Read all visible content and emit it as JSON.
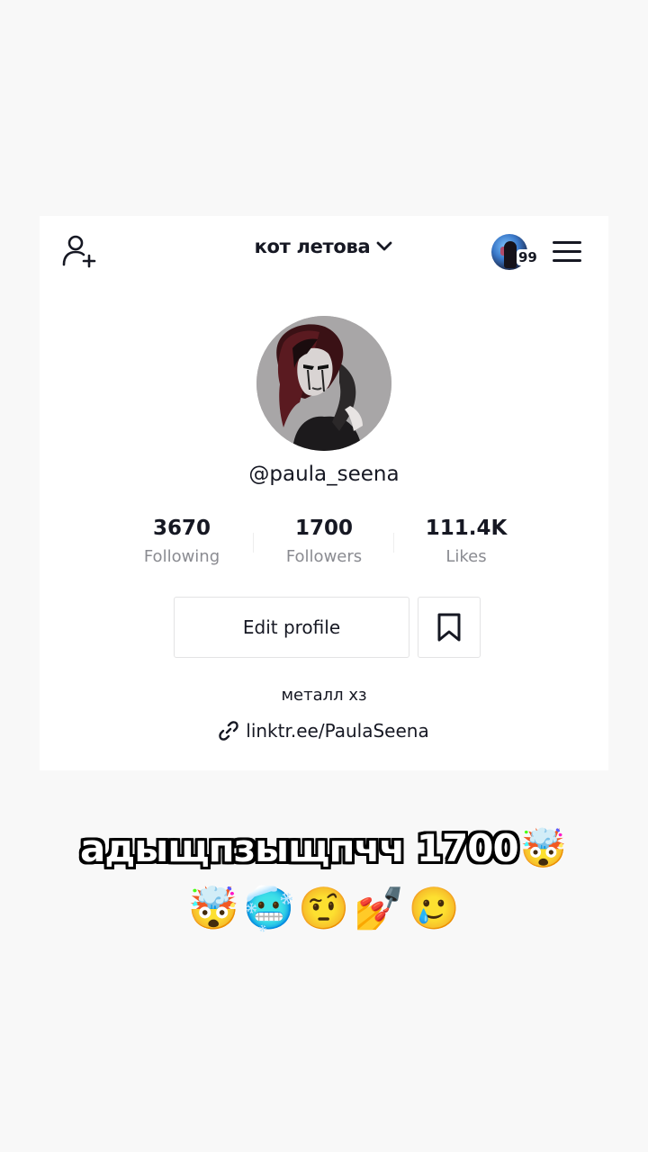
{
  "header": {
    "account_name": "кот летова",
    "story_count": "99"
  },
  "profile": {
    "username": "@paula_seena",
    "stats": [
      {
        "value": "3670",
        "label": "Following"
      },
      {
        "value": "1700",
        "label": "Followers"
      },
      {
        "value": "111.4K",
        "label": "Likes"
      }
    ],
    "edit_label": "Edit profile",
    "bio": "металл хз",
    "link": "linktr.ee/PaulaSeena"
  },
  "overlay": {
    "line1_text": "адыщпзыщпчч 1700",
    "line1_emoji": "🤯",
    "line2_emojis": [
      "🤯",
      "🥶",
      "🤨",
      "💅",
      "🥲"
    ]
  },
  "icons": {
    "add_user": "add-user-icon",
    "chevron": "chevron-down-icon",
    "menu": "hamburger-menu-icon",
    "bookmark": "bookmark-icon",
    "link": "link-icon"
  },
  "colors": {
    "text_primary": "#161823",
    "text_secondary": "#8a8b91",
    "border": "#e3e3e4",
    "card_bg": "#ffffff",
    "page_bg": "#f8f8f8"
  }
}
